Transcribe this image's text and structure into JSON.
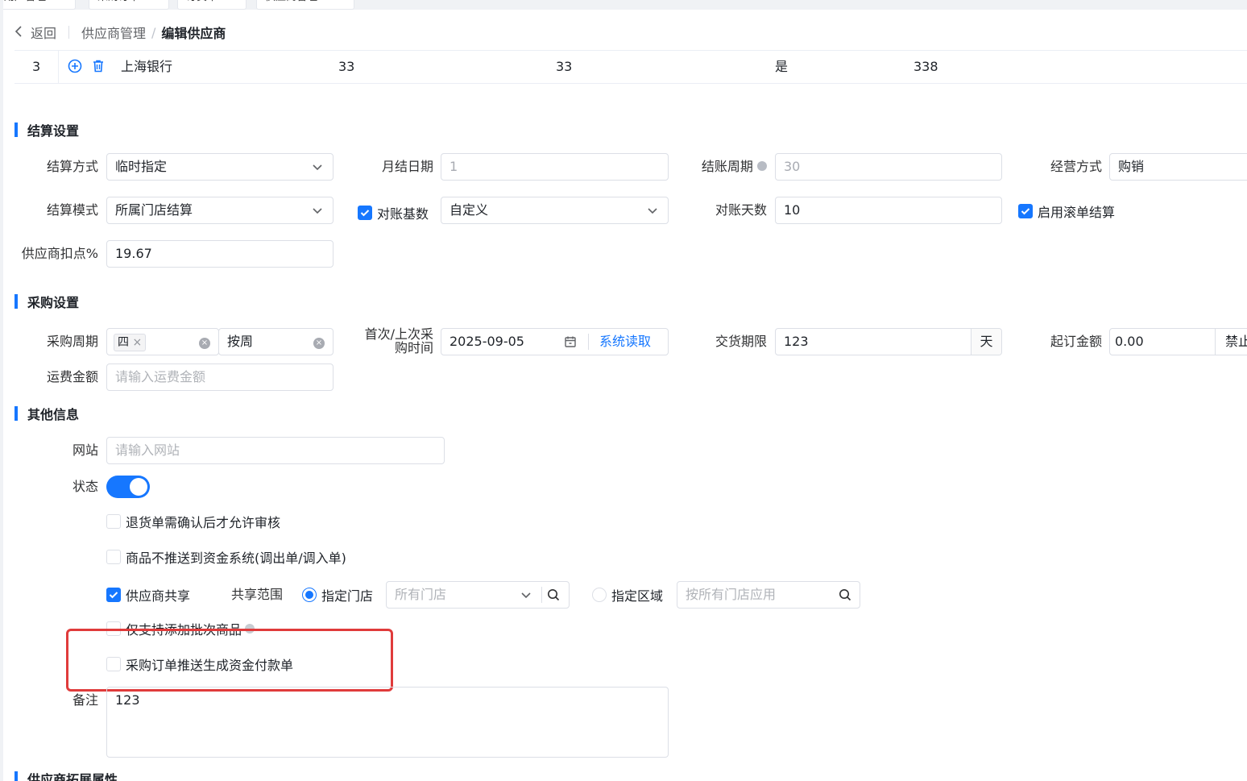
{
  "tabs": [
    "用户管理",
    "采购订单",
    "订货单",
    "供应商管理"
  ],
  "breadcrumb": {
    "back_label": "返回",
    "parent": "供应商管理",
    "current": "编辑供应商"
  },
  "bank_row": {
    "index": "3",
    "bank_name": "上海银行",
    "col_a": "33",
    "col_b": "33",
    "col_c": "是",
    "col_d": "338"
  },
  "sections": {
    "settlement": "结算设置",
    "purchase": "采购设置",
    "other": "其他信息",
    "extension": "供应商拓展属性"
  },
  "settlement": {
    "method_label": "结算方式",
    "method_value": "临时指定",
    "month_day_label": "月结日期",
    "month_day_value": "1",
    "cycle_label": "结账周期",
    "cycle_value": "30",
    "business_label": "经营方式",
    "business_value": "购销",
    "mode_label": "结算模式",
    "mode_value": "所属门店结算",
    "reconcile_base_label": "对账基数",
    "reconcile_base_value": "自定义",
    "reconcile_days_label": "对账天数",
    "reconcile_days_value": "10",
    "rolling_label": "启用滚单结算",
    "deduct_label": "供应商扣点%",
    "deduct_value": "19.67"
  },
  "purchase": {
    "cycle_label": "采购周期",
    "cycle_tag": "四",
    "cycle_unit": "按周",
    "first_time_label_1": "首次/上次采",
    "first_time_label_2": "购时间",
    "first_time_value": "2025-09-05",
    "system_read": "系统读取",
    "delivery_label": "交货期限",
    "delivery_value": "123",
    "delivery_unit": "天",
    "min_amount_label": "起订金额",
    "min_amount_value": "0.00",
    "min_amount_suffix": "禁止",
    "freight_label": "运费金额",
    "freight_placeholder": "请输入运费金额"
  },
  "other": {
    "website_label": "网站",
    "website_placeholder": "请输入网站",
    "status_label": "状态",
    "return_confirm": "退货单需确认后才允许审核",
    "no_push_funds": "商品不推送到资金系统(调出单/调入单)",
    "supplier_share": "供应商共享",
    "share_scope_label": "共享范围",
    "designated_store": "指定门店",
    "store_placeholder": "所有门店",
    "designated_region": "指定区域",
    "region_placeholder": "按所有门店应用",
    "batch_only": "仅支持添加批次商品",
    "po_push_payment": "采购订单推送生成资金付款单",
    "remark_label": "备注",
    "remark_value": "123"
  },
  "colors": {
    "primary": "#1677ff",
    "highlight": "#e03b3b"
  }
}
